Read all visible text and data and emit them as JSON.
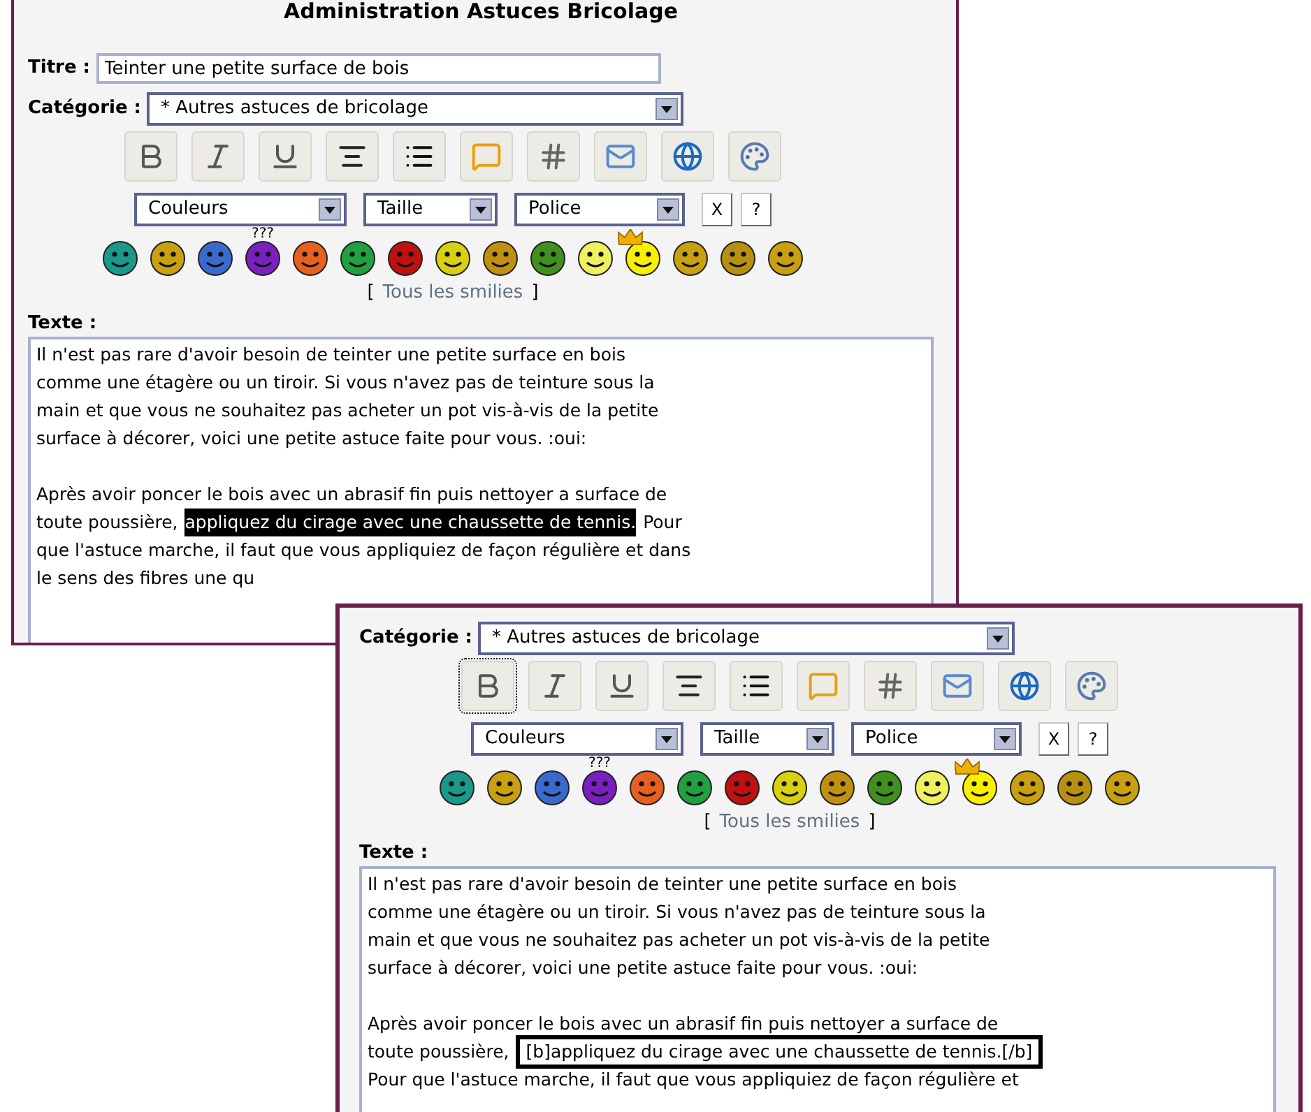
{
  "panels": [
    {
      "title": "Administration Astuces Bricolage",
      "title_field": {
        "label": "Titre :",
        "value": "Teinter une petite surface de bois"
      },
      "category": {
        "label": "Catégorie :",
        "value": "* Autres astuces de bricolage"
      },
      "toolbar": [
        {
          "kind": "bold",
          "focused": false
        },
        {
          "kind": "italic",
          "focused": false
        },
        {
          "kind": "underline",
          "focused": false
        },
        {
          "kind": "center",
          "focused": false
        },
        {
          "kind": "list",
          "focused": false
        },
        {
          "kind": "quote",
          "focused": false
        },
        {
          "kind": "code",
          "focused": false
        },
        {
          "kind": "email",
          "focused": false
        },
        {
          "kind": "url",
          "focused": false
        },
        {
          "kind": "image",
          "focused": false
        }
      ],
      "dropdowns": [
        "Couleurs",
        "Taille",
        "Police"
      ],
      "buttons": [
        "X",
        "?"
      ],
      "smilies": [
        {
          "color": "#1a9a8a"
        },
        {
          "color": "#c8a010"
        },
        {
          "color": "#3a6ad0"
        },
        {
          "color": "#7a20c0",
          "caption": "???"
        },
        {
          "color": "#e86020"
        },
        {
          "color": "#20a040"
        },
        {
          "color": "#c01010"
        },
        {
          "color": "#d8d010"
        },
        {
          "color": "#c09010"
        },
        {
          "color": "#409020"
        },
        {
          "color": "#f0f060"
        },
        {
          "color": "#f8f000",
          "crown": true
        },
        {
          "color": "#c8a010"
        },
        {
          "color": "#b89010"
        },
        {
          "color": "#c8a010"
        }
      ],
      "all_smilies": {
        "open": "[",
        "label": "Tous les smilies",
        "close": "]"
      },
      "text_label": "Texte :",
      "paragraphs": [
        {
          "lines": [
            {
              "segments": [
                {
                  "kind": "plain",
                  "text": "Il n'est pas rare d'avoir besoin de teinter une petite surface en bois"
                }
              ]
            },
            {
              "segments": [
                {
                  "kind": "plain",
                  "text": "comme une étagère ou un tiroir. Si vous n'avez pas de teinture sous la"
                }
              ]
            },
            {
              "segments": [
                {
                  "kind": "plain",
                  "text": "main et que vous ne souhaitez pas acheter un pot vis-à-vis de la petite"
                }
              ]
            },
            {
              "segments": [
                {
                  "kind": "plain",
                  "text": "surface à décorer, voici une petite astuce faite pour vous.  :oui:"
                }
              ]
            }
          ]
        },
        {
          "lines": [
            {
              "segments": [
                {
                  "kind": "plain",
                  "text": "Après avoir poncer le bois avec un abrasif fin puis nettoyer a surface de"
                }
              ]
            },
            {
              "segments": [
                {
                  "kind": "plain",
                  "text": "toute poussière,"
                },
                {
                  "kind": "selected",
                  "text": "appliquez du cirage avec une chaussette de tennis."
                },
                {
                  "kind": "plain",
                  "text": "Pour"
                }
              ]
            },
            {
              "segments": [
                {
                  "kind": "plain",
                  "text": "que l'astuce marche, il faut que vous appliquiez de façon régulière et dans"
                }
              ]
            },
            {
              "segments": [
                {
                  "kind": "plain",
                  "text": "le sens des fibres une qu"
                }
              ]
            }
          ]
        }
      ]
    },
    {
      "category": {
        "label": "Catégorie :",
        "value": "* Autres astuces de bricolage"
      },
      "toolbar": [
        {
          "kind": "bold",
          "focused": true
        },
        {
          "kind": "italic",
          "focused": false
        },
        {
          "kind": "underline",
          "focused": false
        },
        {
          "kind": "center",
          "focused": false
        },
        {
          "kind": "list",
          "focused": false
        },
        {
          "kind": "quote",
          "focused": false
        },
        {
          "kind": "code",
          "focused": false
        },
        {
          "kind": "email",
          "focused": false
        },
        {
          "kind": "url",
          "focused": false
        },
        {
          "kind": "image",
          "focused": false
        }
      ],
      "dropdowns": [
        "Couleurs",
        "Taille",
        "Police"
      ],
      "buttons": [
        "X",
        "?"
      ],
      "smilies": [
        {
          "color": "#1a9a8a"
        },
        {
          "color": "#c8a010"
        },
        {
          "color": "#3a6ad0"
        },
        {
          "color": "#7a20c0",
          "caption": "???"
        },
        {
          "color": "#e86020"
        },
        {
          "color": "#20a040"
        },
        {
          "color": "#c01010"
        },
        {
          "color": "#d8d010"
        },
        {
          "color": "#c09010"
        },
        {
          "color": "#409020"
        },
        {
          "color": "#f0f060"
        },
        {
          "color": "#f8f000",
          "crown": true
        },
        {
          "color": "#c8a010"
        },
        {
          "color": "#b89010"
        },
        {
          "color": "#c8a010"
        }
      ],
      "all_smilies": {
        "open": "[",
        "label": "Tous les smilies",
        "close": "]"
      },
      "text_label": "Texte :",
      "paragraphs": [
        {
          "lines": [
            {
              "segments": [
                {
                  "kind": "plain",
                  "text": "Il n'est pas rare d'avoir besoin de teinter une petite surface en bois"
                }
              ]
            },
            {
              "segments": [
                {
                  "kind": "plain",
                  "text": "comme une étagère ou un tiroir. Si vous n'avez pas de teinture sous la"
                }
              ]
            },
            {
              "segments": [
                {
                  "kind": "plain",
                  "text": "main et que vous ne souhaitez pas acheter un pot vis-à-vis de la petite"
                }
              ]
            },
            {
              "segments": [
                {
                  "kind": "plain",
                  "text": "surface à décorer, voici une petite astuce faite pour vous.  :oui:"
                }
              ]
            }
          ]
        },
        {
          "lines": [
            {
              "segments": [
                {
                  "kind": "plain",
                  "text": "Après avoir poncer le bois avec un abrasif fin puis nettoyer a surface de"
                }
              ]
            },
            {
              "segments": [
                {
                  "kind": "plain",
                  "text": "toute poussière,"
                },
                {
                  "kind": "callout",
                  "text": "[b]appliquez du cirage avec une chaussette de tennis.[/b]"
                }
              ]
            },
            {
              "segments": [
                {
                  "kind": "plain",
                  "text": "Pour que l'astuce marche, il faut que vous appliquiez de façon régulière et"
                }
              ]
            }
          ]
        }
      ]
    }
  ]
}
